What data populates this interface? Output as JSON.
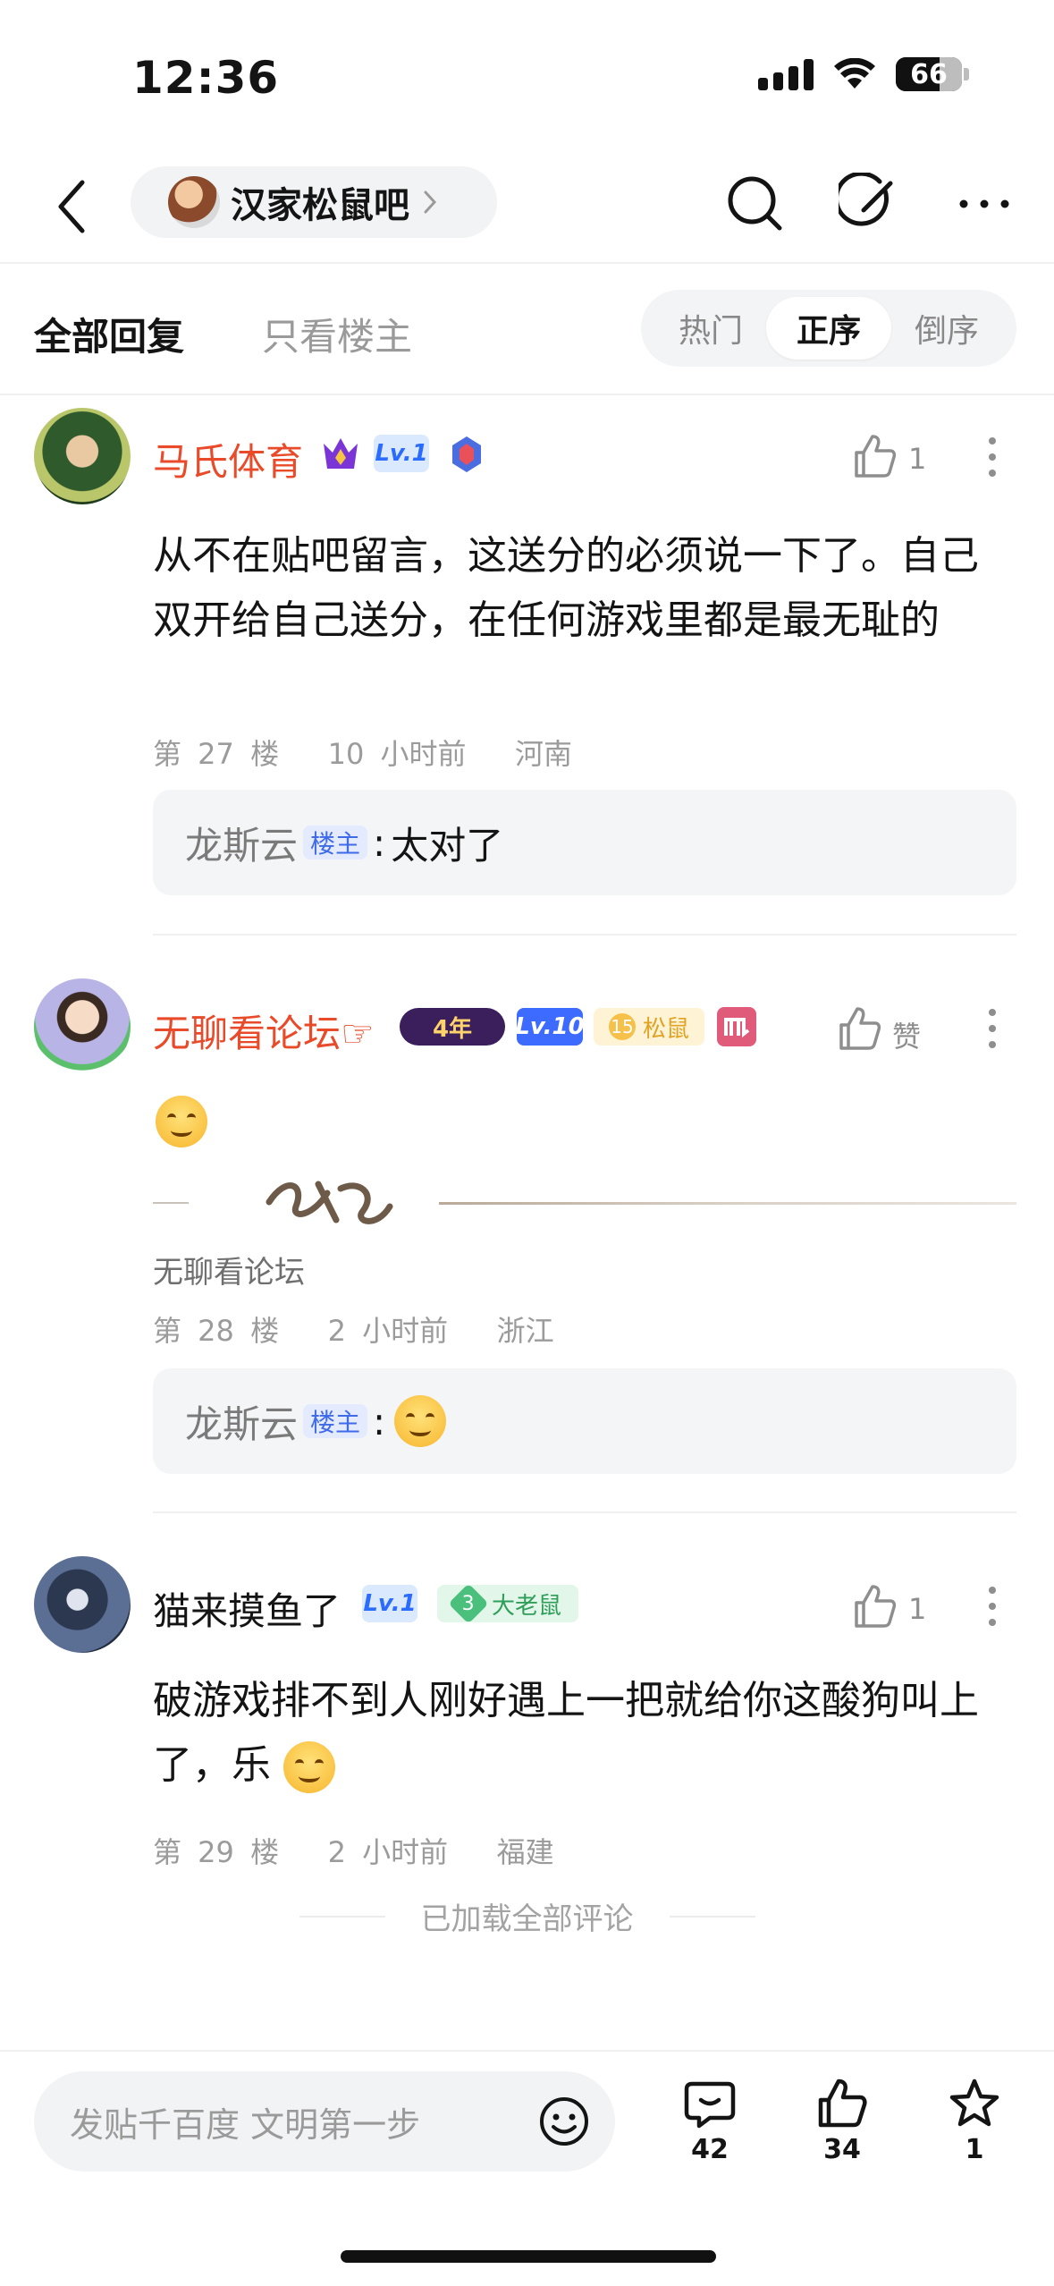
{
  "status_bar": {
    "time": "12:36",
    "battery": "66"
  },
  "nav": {
    "forum_name": "汉家松鼠吧"
  },
  "filters": {
    "all_replies": "全部回复",
    "op_only": "只看楼主",
    "sort_hot": "热门",
    "sort_asc": "正序",
    "sort_desc": "倒序",
    "active_sort": "正序"
  },
  "posts": [
    {
      "username": "马氏体育",
      "level": "Lv.1",
      "likes": "1",
      "text": "从不在贴吧留言，这送分的必须说一下了。自己双开给自己送分，在任何游戏里都是最无耻的",
      "floor": "第 27 楼",
      "time": "10 小时前",
      "location": "河南",
      "reply": {
        "name": "龙斯云",
        "tag": "楼主",
        "text": "太对了"
      }
    },
    {
      "username": "无聊看论坛",
      "name_suffix": "☞",
      "years_badge": "4年",
      "level": "Lv.10",
      "fan_level": "15",
      "fan_title": "松鼠",
      "likes_label": "赞",
      "signature_name": "无聊看论坛",
      "floor": "第 28 楼",
      "time": "2 小时前",
      "location": "浙江",
      "reply": {
        "name": "龙斯云",
        "tag": "楼主"
      }
    },
    {
      "username": "猫来摸鱼了",
      "level": "Lv.1",
      "fan_level": "3",
      "fan_title": "大老鼠",
      "likes": "1",
      "text": "破游戏排不到人刚好遇上一把就给你这酸狗叫上了，乐",
      "floor": "第 29 楼",
      "time": "2 小时前",
      "location": "福建"
    }
  ],
  "loaded_all": "已加载全部评论",
  "bottom_bar": {
    "composer_placeholder": "发贴千百度 文明第一步",
    "comments": "42",
    "likes": "34",
    "favorites": "1"
  },
  "colors": {
    "accent_red": "#e94b2a",
    "level_blue": "#2b6cff",
    "op_tag_blue": "#3f6ae8"
  }
}
